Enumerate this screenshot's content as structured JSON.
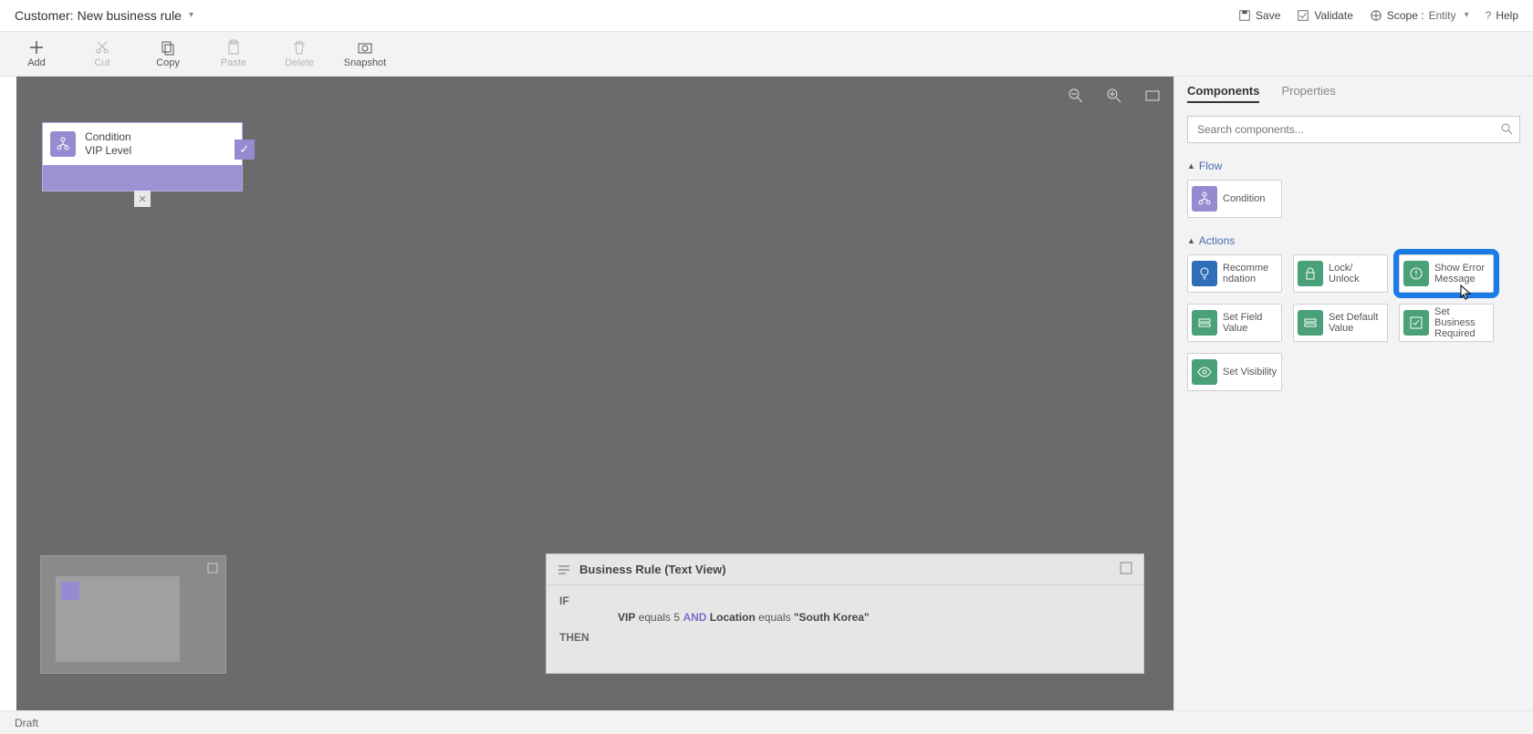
{
  "header": {
    "titlePrefix": "Customer:",
    "title": "New business rule",
    "save": "Save",
    "validate": "Validate",
    "scopeLabel": "Scope :",
    "scopeValue": "Entity",
    "help": "Help"
  },
  "toolbar": {
    "add": "Add",
    "cut": "Cut",
    "copy": "Copy",
    "paste": "Paste",
    "delete": "Delete",
    "snapshot": "Snapshot"
  },
  "canvas": {
    "condition": {
      "type": "Condition",
      "name": "VIP Level"
    }
  },
  "textview": {
    "title": "Business Rule (Text View)",
    "ifLabel": "IF",
    "thenLabel": "THEN",
    "field1": "VIP",
    "op1": "equals",
    "val1": "5",
    "and": "AND",
    "field2": "Location",
    "op2": "equals",
    "val2": "\"South Korea\""
  },
  "rpanel": {
    "tabComponents": "Components",
    "tabProperties": "Properties",
    "searchPlaceholder": "Search components...",
    "flow": "Flow",
    "actions": "Actions",
    "items": {
      "condition": "Condition",
      "recommendation": "Recomme ndation",
      "lockUnlock": "Lock/ Unlock",
      "showError": "Show Error Message",
      "setField": "Set Field Value",
      "setDefault": "Set Default Value",
      "setBusiness": "Set Business Required",
      "setVisibility": "Set Visibility"
    }
  },
  "status": {
    "draft": "Draft"
  }
}
